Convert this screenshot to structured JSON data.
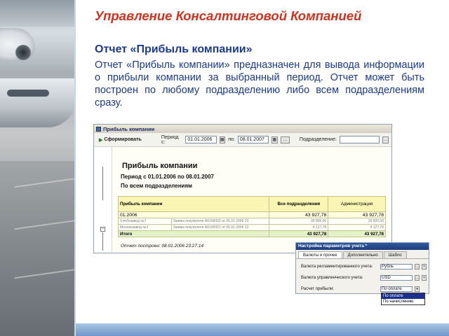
{
  "slide": {
    "title": "Управление Консалтинговой Компанией",
    "subtitle": "Отчет «Прибыль компании»",
    "description": "Отчет «Прибыль компании» предназначен для вывода информации о прибыли компании за выбранный период. Отчет может быть построен по любому подразделению либо всем подразделениям сразу."
  },
  "report_window": {
    "title": "Прибыль компании",
    "toolbar": {
      "generate_label": "Сформировать",
      "period_from_label": "Период с:",
      "period_from_value": "01.01.2006",
      "period_to_label": "по:",
      "period_to_value": "08.01.2007",
      "ellipsis": "...",
      "department_label": "Подразделение:",
      "department_value": ""
    },
    "heading": "Прибыль компании",
    "period_line": "Период с 01.01.2006 по 08.01.2007",
    "scope_line": "По всем подразделениям",
    "table": {
      "headers": [
        "Прибыль компании",
        "Все подразделения",
        "Администрация"
      ],
      "group_row": {
        "label": "01.2006",
        "all": "43 927,78",
        "admin": "43 927,78"
      },
      "detail_rows": [
        {
          "c1": "Хлебозавод №7",
          "c2": "Заявка покупателя А0106002 от 05.01.2006 23",
          "all": "39 800,00",
          "admin": "39 800,00"
        },
        {
          "c1": "Молокозавод №1",
          "c2": "Заявка покупателя А0106001 от 05.01.2006 23",
          "all": "4 127,78",
          "admin": "4 127,78"
        }
      ],
      "total_row": {
        "label": "Итого",
        "all": "43 927,78",
        "admin": "43 927,78"
      }
    },
    "footer": "Отчет построен: 08.01.2006 23:27:14"
  },
  "settings_window": {
    "title": "Настройка параметров учета *",
    "tabs": [
      "Валюты и прочее",
      "Дополнительно",
      "Шабло"
    ],
    "rows": [
      {
        "label": "Валюта регламентированного учета:",
        "value": "Рубль"
      },
      {
        "label": "Валюта управленческого учета:",
        "value": "USD"
      },
      {
        "label": "Расчет прибыли:",
        "value": "По оплате"
      }
    ],
    "dropdown_options": [
      "По оплате",
      "По начислению"
    ],
    "dropdown_selected_index": 0
  },
  "colors": {
    "title": "#d2321d",
    "text": "#1a3a8f",
    "band": "#6f97c8"
  }
}
